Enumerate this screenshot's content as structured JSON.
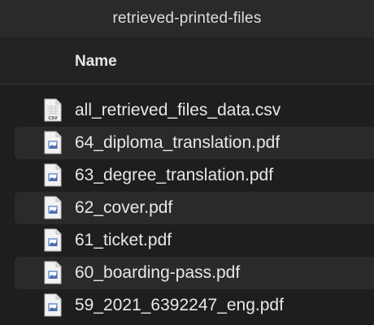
{
  "window": {
    "title": "retrieved-printed-files"
  },
  "list": {
    "column_header": "Name",
    "files": [
      {
        "name": "all_retrieved_files_data.csv",
        "icon": "csv-file-icon",
        "badge": "CSV"
      },
      {
        "name": "64_diploma_translation.pdf",
        "icon": "pdf-file-icon"
      },
      {
        "name": "63_degree_translation.pdf",
        "icon": "pdf-file-icon"
      },
      {
        "name": "62_cover.pdf",
        "icon": "pdf-file-icon"
      },
      {
        "name": "61_ticket.pdf",
        "icon": "pdf-file-icon"
      },
      {
        "name": "60_boarding-pass.pdf",
        "icon": "pdf-file-icon"
      },
      {
        "name": "59_2021_6392247_eng.pdf",
        "icon": "pdf-file-icon"
      }
    ]
  },
  "colors": {
    "background": "#1e1e1e",
    "titlebar": "#2a2a2a",
    "alt_row": "#2a2a2a",
    "text": "#e8e8e8"
  }
}
